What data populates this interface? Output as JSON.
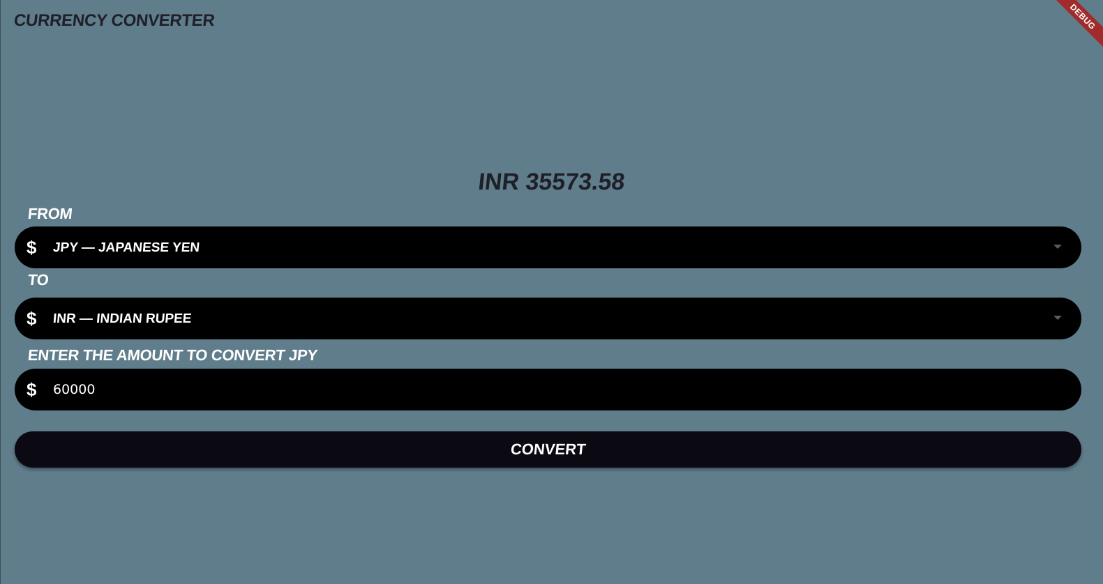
{
  "app": {
    "title": "Currency Converter",
    "debug_banner": "DEBUG"
  },
  "result": {
    "text": "INR 35573.58"
  },
  "from": {
    "label": "From",
    "icon": "dollar-icon",
    "icon_glyph": "$",
    "selected": "JPY — Japanese Yen"
  },
  "to": {
    "label": "To",
    "icon": "dollar-icon",
    "icon_glyph": "$",
    "selected": "INR — Indian Rupee"
  },
  "amount": {
    "label": "Enter the amount to convert JPY",
    "icon": "dollar-icon",
    "icon_glyph": "$",
    "value": "60000"
  },
  "convert_button": {
    "label": "Convert"
  },
  "colors": {
    "background": "#607d8b",
    "field": "#000000",
    "button": "#0b0a12",
    "title_text": "#1f1f28",
    "debug_banner": "#a12a2a"
  }
}
